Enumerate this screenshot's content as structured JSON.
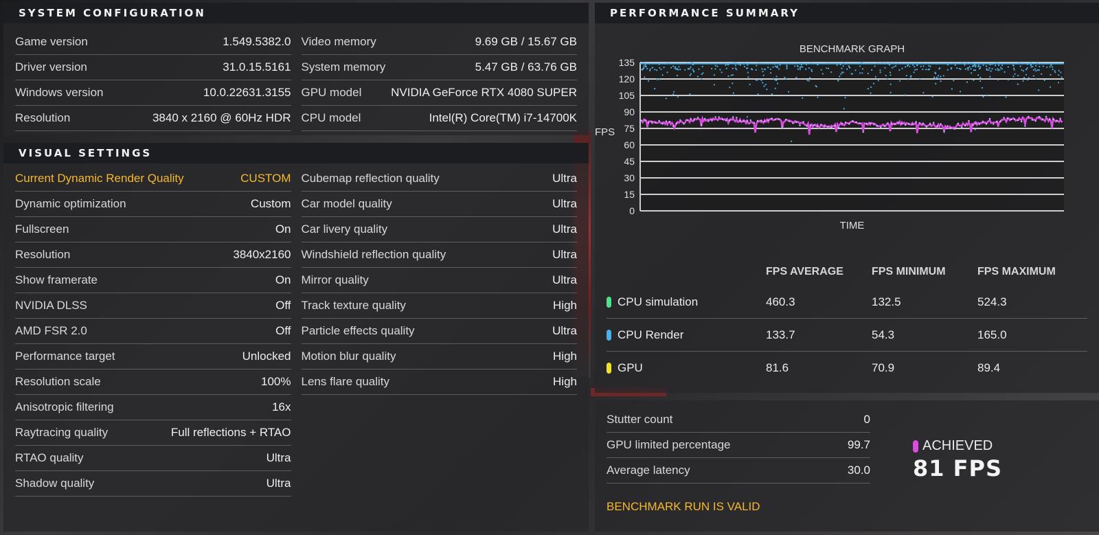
{
  "system": {
    "title": "SYSTEM CONFIGURATION",
    "left": [
      {
        "label": "Game version",
        "value": "1.549.5382.0"
      },
      {
        "label": "Driver version",
        "value": "31.0.15.5161"
      },
      {
        "label": "Windows version",
        "value": "10.0.22631.3155"
      },
      {
        "label": "Resolution",
        "value": "3840 x 2160 @ 60Hz HDR"
      }
    ],
    "right": [
      {
        "label": "Video memory",
        "value": "9.69 GB / 15.67 GB"
      },
      {
        "label": "System memory",
        "value": "5.47 GB / 63.76 GB"
      },
      {
        "label": "GPU model",
        "value": "NVIDIA GeForce RTX 4080 SUPER"
      },
      {
        "label": "CPU model",
        "value": "Intel(R) Core(TM) i7-14700K"
      }
    ]
  },
  "visual": {
    "title": "VISUAL SETTINGS",
    "left": [
      {
        "label": "Current Dynamic Render Quality",
        "value": "CUSTOM"
      },
      {
        "label": "Dynamic optimization",
        "value": "Custom"
      },
      {
        "label": "Fullscreen",
        "value": "On"
      },
      {
        "label": "Resolution",
        "value": "3840x2160"
      },
      {
        "label": "Show framerate",
        "value": "On"
      },
      {
        "label": "NVIDIA DLSS",
        "value": "Off"
      },
      {
        "label": "AMD FSR 2.0",
        "value": "Off"
      },
      {
        "label": "Performance target",
        "value": "Unlocked"
      },
      {
        "label": "Resolution scale",
        "value": "100%"
      },
      {
        "label": "Anisotropic filtering",
        "value": "16x"
      },
      {
        "label": "Raytracing quality",
        "value": "Full reflections + RTAO"
      },
      {
        "label": "RTAO quality",
        "value": "Ultra"
      },
      {
        "label": "Shadow quality",
        "value": "Ultra"
      }
    ],
    "right": [
      {
        "label": "Cubemap reflection quality",
        "value": "Ultra"
      },
      {
        "label": "Car model quality",
        "value": "Ultra"
      },
      {
        "label": "Car livery quality",
        "value": "Ultra"
      },
      {
        "label": "Windshield reflection quality",
        "value": "Ultra"
      },
      {
        "label": "Mirror quality",
        "value": "Ultra"
      },
      {
        "label": "Track texture quality",
        "value": "High"
      },
      {
        "label": "Particle effects quality",
        "value": "Ultra"
      },
      {
        "label": "Motion blur quality",
        "value": "High"
      },
      {
        "label": "Lens flare quality",
        "value": "High"
      }
    ]
  },
  "performance": {
    "title": "PERFORMANCE SUMMARY",
    "table": {
      "headers": [
        "",
        "FPS AVERAGE",
        "FPS MINIMUM",
        "FPS MAXIMUM"
      ],
      "rows": [
        {
          "name": "CPU simulation",
          "color": "#4ee08a",
          "avg": "460.3",
          "min": "132.5",
          "max": "524.3"
        },
        {
          "name": "CPU Render",
          "color": "#4ab0e6",
          "avg": "133.7",
          "min": "54.3",
          "max": "165.0"
        },
        {
          "name": "GPU",
          "color": "#f2e230",
          "avg": "81.6",
          "min": "70.9",
          "max": "89.4"
        }
      ]
    }
  },
  "chart_data": {
    "type": "scatter",
    "title": "BENCHMARK GRAPH",
    "xlabel": "TIME",
    "ylabel": "FPS",
    "ylim": [
      0,
      135
    ],
    "yticks": [
      0,
      15,
      30,
      45,
      60,
      75,
      90,
      105,
      120,
      135
    ],
    "grid": true,
    "series": [
      {
        "name": "CPU Render",
        "color": "#4ab0e6",
        "mean": 133.7,
        "min": 54.3,
        "max": 165.0
      },
      {
        "name": "GPU",
        "color": "#d94ce0",
        "mean": 81.6,
        "min": 70.9,
        "max": 89.4,
        "profile": [
          82,
          81,
          79,
          82,
          83,
          84,
          82,
          80,
          83,
          82,
          79,
          77,
          78,
          80,
          79,
          78,
          80,
          79,
          78,
          76,
          79,
          80,
          82,
          83,
          84,
          83,
          82
        ]
      }
    ]
  },
  "summary": {
    "rows": [
      {
        "label": "Stutter count",
        "value": "0"
      },
      {
        "label": "GPU limited percentage",
        "value": "99.7"
      },
      {
        "label": "Average latency",
        "value": "30.0"
      }
    ],
    "valid_text": "BENCHMARK RUN IS VALID",
    "achieved_label": "ACHIEVED",
    "achieved_value": "81 FPS",
    "achieved_color": "#d94ce0"
  }
}
